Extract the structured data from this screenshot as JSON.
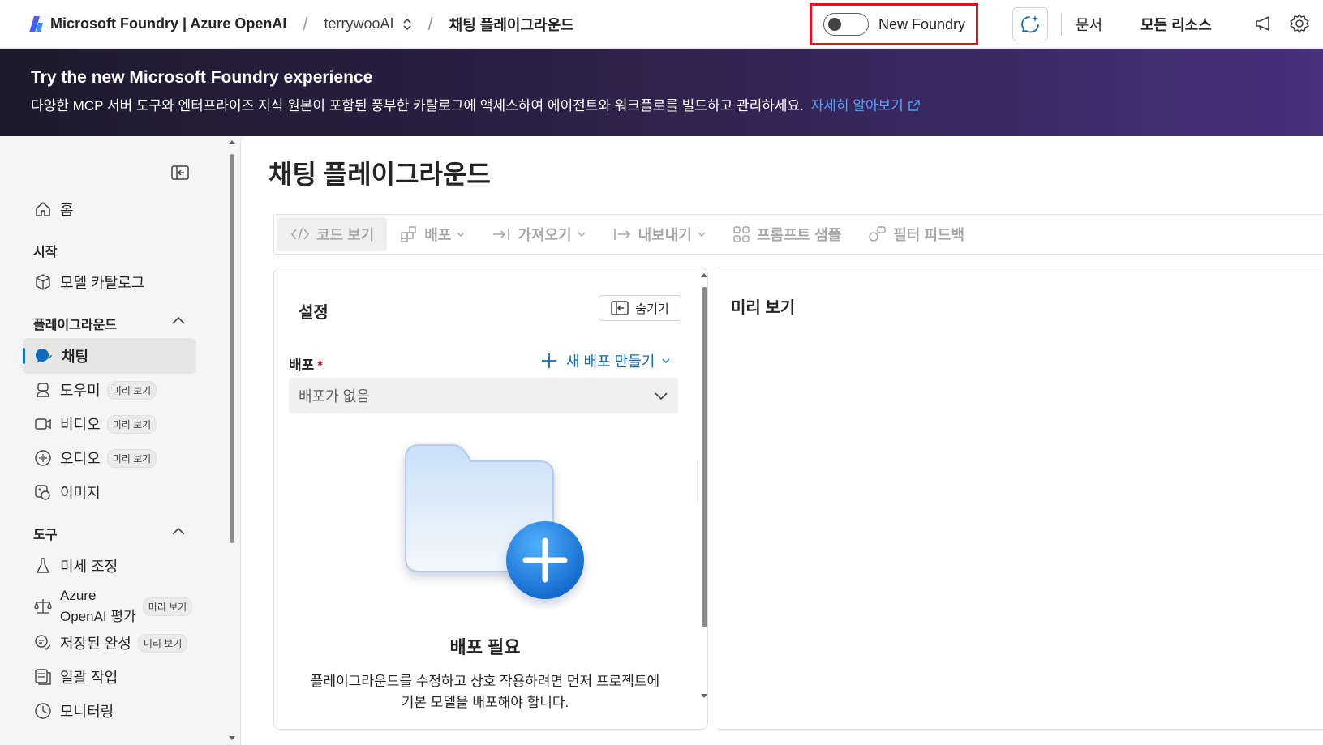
{
  "topbar": {
    "brand": "Microsoft Foundry | Azure OpenAI",
    "project": "terrywooAI",
    "breadcrumb_current": "채팅 플레이그라운드",
    "new_foundry_label": "New Foundry",
    "new_foundry_toggle_on": false,
    "docs_label": "문서",
    "all_resources_label": "모든 리소스",
    "icons": [
      "copilot-icon",
      "megaphone-icon",
      "gear-icon"
    ]
  },
  "banner": {
    "title": "Try the new Microsoft Foundry experience",
    "text": "다양한 MCP 서버 도구와 엔터프라이즈 지식 원본이 포함된 풍부한 카탈로그에 액세스하여 에이전트와 워크플로를 빌드하고 관리하세요.",
    "link": "자세히 알아보기"
  },
  "sidebar": {
    "home": "홈",
    "section_start": "시작",
    "model_catalog": "모델 카탈로그",
    "section_playground": "플레이그라운드",
    "chat": "채팅",
    "assistant": "도우미",
    "video": "비디오",
    "audio": "오디오",
    "image": "이미지",
    "section_tools": "도구",
    "finetune": "미세 조정",
    "eval_line1": "Azure",
    "eval_line2": "OpenAI 평가",
    "saved_completions": "저장된 완성",
    "batch": "일괄 작업",
    "monitoring": "모니터링",
    "preview_badge": "미리 보기"
  },
  "main": {
    "title": "채팅 플레이그라운드",
    "toolbar": {
      "view_code": "코드 보기",
      "deploy": "배포",
      "import": "가져오기",
      "export": "내보내기",
      "prompt_samples": "프롬프트 샘플",
      "filter_feedback": "필터 피드백"
    },
    "settings": {
      "title": "설정",
      "hide": "숨기기",
      "deployment_label": "배포",
      "required_mark": "*",
      "new_deployment": "새 배포 만들기",
      "select_value": "배포가 없음",
      "required_title": "배포 필요",
      "required_desc_line1": "플레이그라운드를 수정하고 상호 작용하려면 먼저 프로젝트에",
      "required_desc_line2": "기본 모델을 배포해야 합니다."
    },
    "preview_title": "미리 보기"
  },
  "colors": {
    "accent": "#0f6cbd",
    "highlight_box": "#e0141e",
    "banner_start": "#1d1a2c",
    "banner_end": "#4a2f7c"
  }
}
